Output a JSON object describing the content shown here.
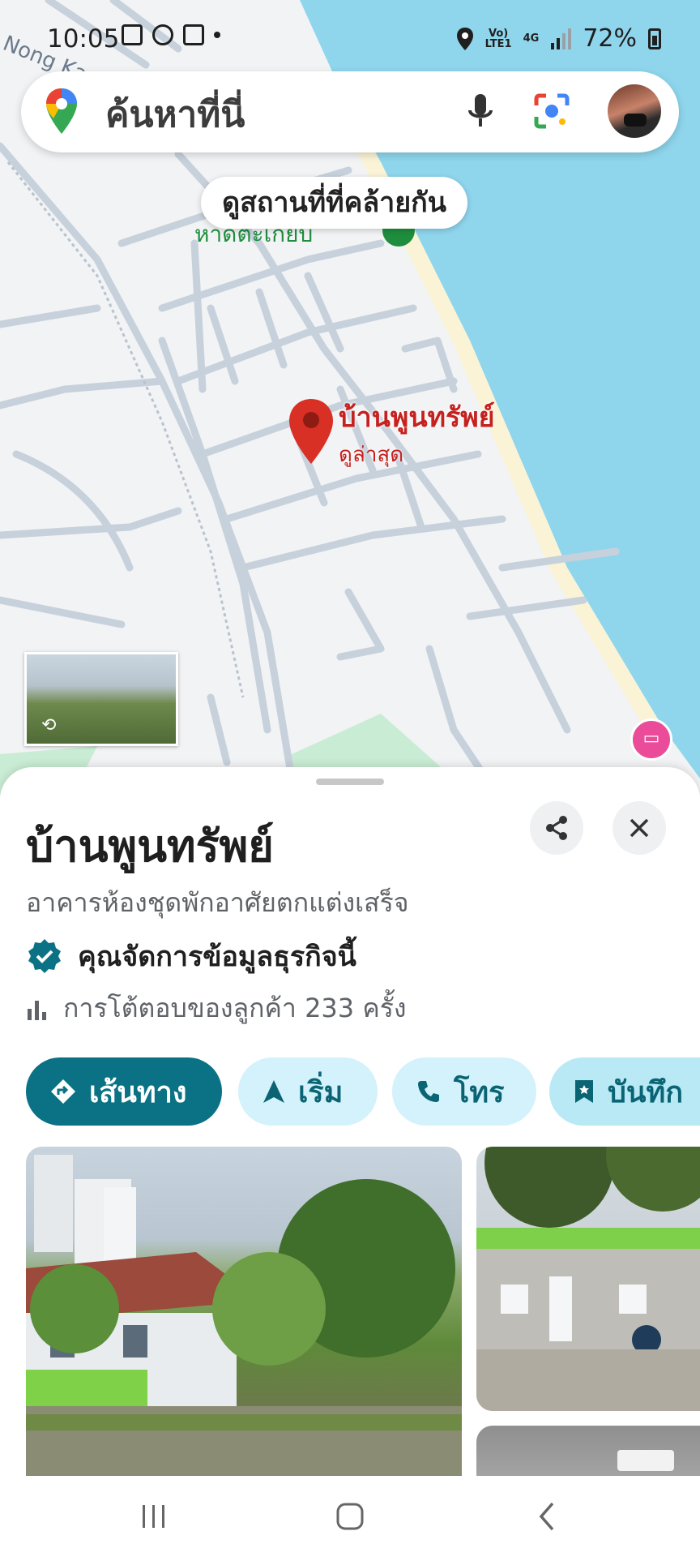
{
  "status_bar": {
    "time": "10:05",
    "network_top": "Vo)",
    "network_bottom": "LTE1",
    "network_type": "4G",
    "battery_percent": "72%"
  },
  "search": {
    "placeholder": "ค้นหาที่นี่"
  },
  "map": {
    "similar_places_chip": "ดูสถานที่ที่คล้ายกัน",
    "marker_label": "บ้านพูนทรัพย์",
    "marker_sublabel": "ดูล่าสุด"
  },
  "place": {
    "name": "บ้านพูนทรัพย์",
    "category": "อาคารห้องชุดพักอาศัยตกแต่งเสร็จ",
    "verified_text": "คุณจัดการข้อมูลธุรกิจนี้",
    "interactions_text": "การโต้ตอบของลูกค้า 233 ครั้ง"
  },
  "actions": [
    {
      "label": "เส้นทาง"
    },
    {
      "label": "เริ่ม"
    },
    {
      "label": "โทร"
    },
    {
      "label": "บันทึก"
    }
  ],
  "colors": {
    "accent": "#0b7285",
    "accent_light": "#d3f2fb",
    "water": "#8fd6ed",
    "marker": "#d93025"
  }
}
